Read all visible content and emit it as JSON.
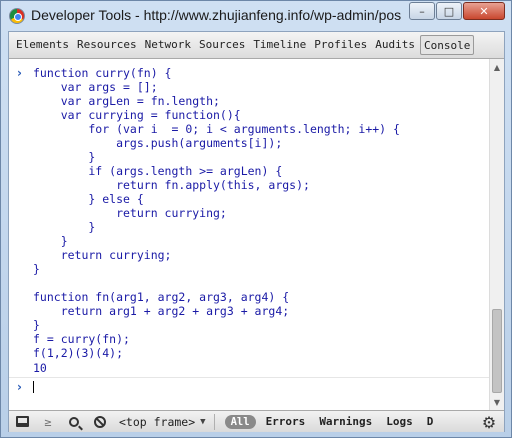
{
  "window": {
    "title": "Developer Tools - http://www.zhujianfeng.info/wp-admin/post...",
    "controls": {
      "minimize": "–",
      "restore": "□",
      "close": "✕"
    }
  },
  "tabs": [
    {
      "label": "Elements"
    },
    {
      "label": "Resources"
    },
    {
      "label": "Network"
    },
    {
      "label": "Sources"
    },
    {
      "label": "Timeline"
    },
    {
      "label": "Profiles"
    },
    {
      "label": "Audits"
    },
    {
      "label": "Console",
      "active": true
    }
  ],
  "console": {
    "input_prompt": "›",
    "lines": [
      "function curry(fn) {",
      "    var args = [];",
      "    var argLen = fn.length;",
      "    var currying = function(){",
      "        for (var i  = 0; i < arguments.length; i++) {",
      "            args.push(arguments[i]);",
      "        }",
      "        if (args.length >= argLen) {",
      "            return fn.apply(this, args);",
      "        } else {",
      "            return currying;",
      "        }",
      "    }",
      "    return currying;",
      "}",
      "",
      "function fn(arg1, arg2, arg3, arg4) {",
      "    return arg1 + arg2 + arg3 + arg4;",
      "}",
      "f = curry(fn);",
      "f(1,2)(3)(4);"
    ],
    "result": "10",
    "prompt": "›"
  },
  "toolbar": {
    "frame_select": "<top frame>",
    "frame_arrow": "▼",
    "filter_all": "All",
    "filters": [
      "Errors",
      "Warnings",
      "Logs",
      "D"
    ]
  },
  "scrollbar": {
    "up": "▲",
    "down": "▼"
  }
}
